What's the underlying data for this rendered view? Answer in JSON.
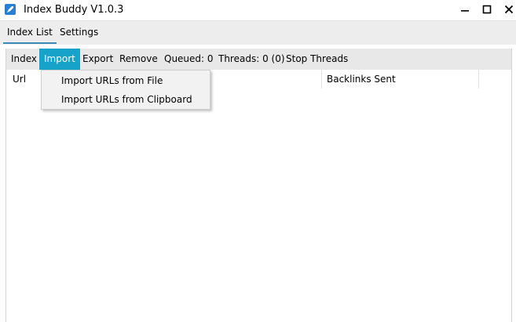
{
  "window": {
    "title": "Index Buddy V1.0.3",
    "minimize_glyph": "—",
    "maximize_glyph": "□",
    "close_glyph": "✕"
  },
  "tabs": [
    {
      "label": "Index List",
      "selected": true
    },
    {
      "label": "Settings",
      "selected": false
    }
  ],
  "toolbar": {
    "index_label": "Index",
    "import_label": "Import",
    "export_label": "Export",
    "remove_label": "Remove",
    "queued_label": "Queued: 0",
    "threads_label": "Threads: 0 (0)",
    "stop_label": "Stop Threads"
  },
  "list": {
    "columns": [
      "Url",
      "Backlinks Sent"
    ]
  },
  "import_menu": {
    "items": [
      "Import URLs from File",
      "Import URLs from Clipboard"
    ]
  },
  "colors": {
    "accent": "#17a2c9",
    "tab_underline": "#3c8ab8",
    "app_icon": "#2a7fd4"
  },
  "icons": {
    "app": "rocket-icon",
    "minimize": "minimize-icon",
    "maximize": "maximize-icon",
    "close": "close-icon"
  }
}
